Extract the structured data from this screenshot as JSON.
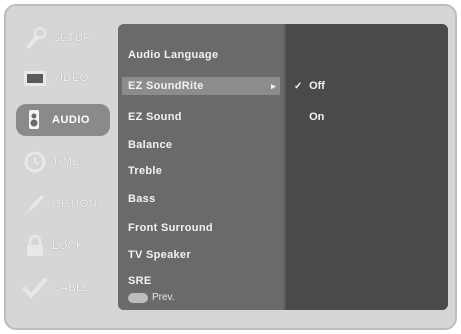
{
  "sidebar": {
    "items": [
      {
        "label": "SETUP",
        "icon": "setup-icon"
      },
      {
        "label": "VIDEO",
        "icon": "video-icon"
      },
      {
        "label": "AUDIO",
        "icon": "audio-icon"
      },
      {
        "label": "TIME",
        "icon": "time-icon"
      },
      {
        "label": "OPTION",
        "icon": "option-icon"
      },
      {
        "label": "LOCK",
        "icon": "lock-icon"
      },
      {
        "label": "CABLE",
        "icon": "cable-icon"
      }
    ]
  },
  "menu": {
    "items": [
      {
        "label": "Audio Language"
      },
      {
        "label": "EZ SoundRite"
      },
      {
        "label": "EZ Sound"
      },
      {
        "label": "Balance"
      },
      {
        "label": "Treble"
      },
      {
        "label": "Bass"
      },
      {
        "label": "Front Surround"
      },
      {
        "label": "TV Speaker"
      },
      {
        "label": "SRE"
      }
    ],
    "arrow": "▸",
    "footer_label": "Prev."
  },
  "submenu": {
    "check": "✓",
    "options": [
      {
        "label": "Off"
      },
      {
        "label": "On"
      }
    ]
  },
  "colors": {
    "panel": "#5a5a5a",
    "highlight": "#8c8c8c",
    "text": "#f2f2f2"
  }
}
